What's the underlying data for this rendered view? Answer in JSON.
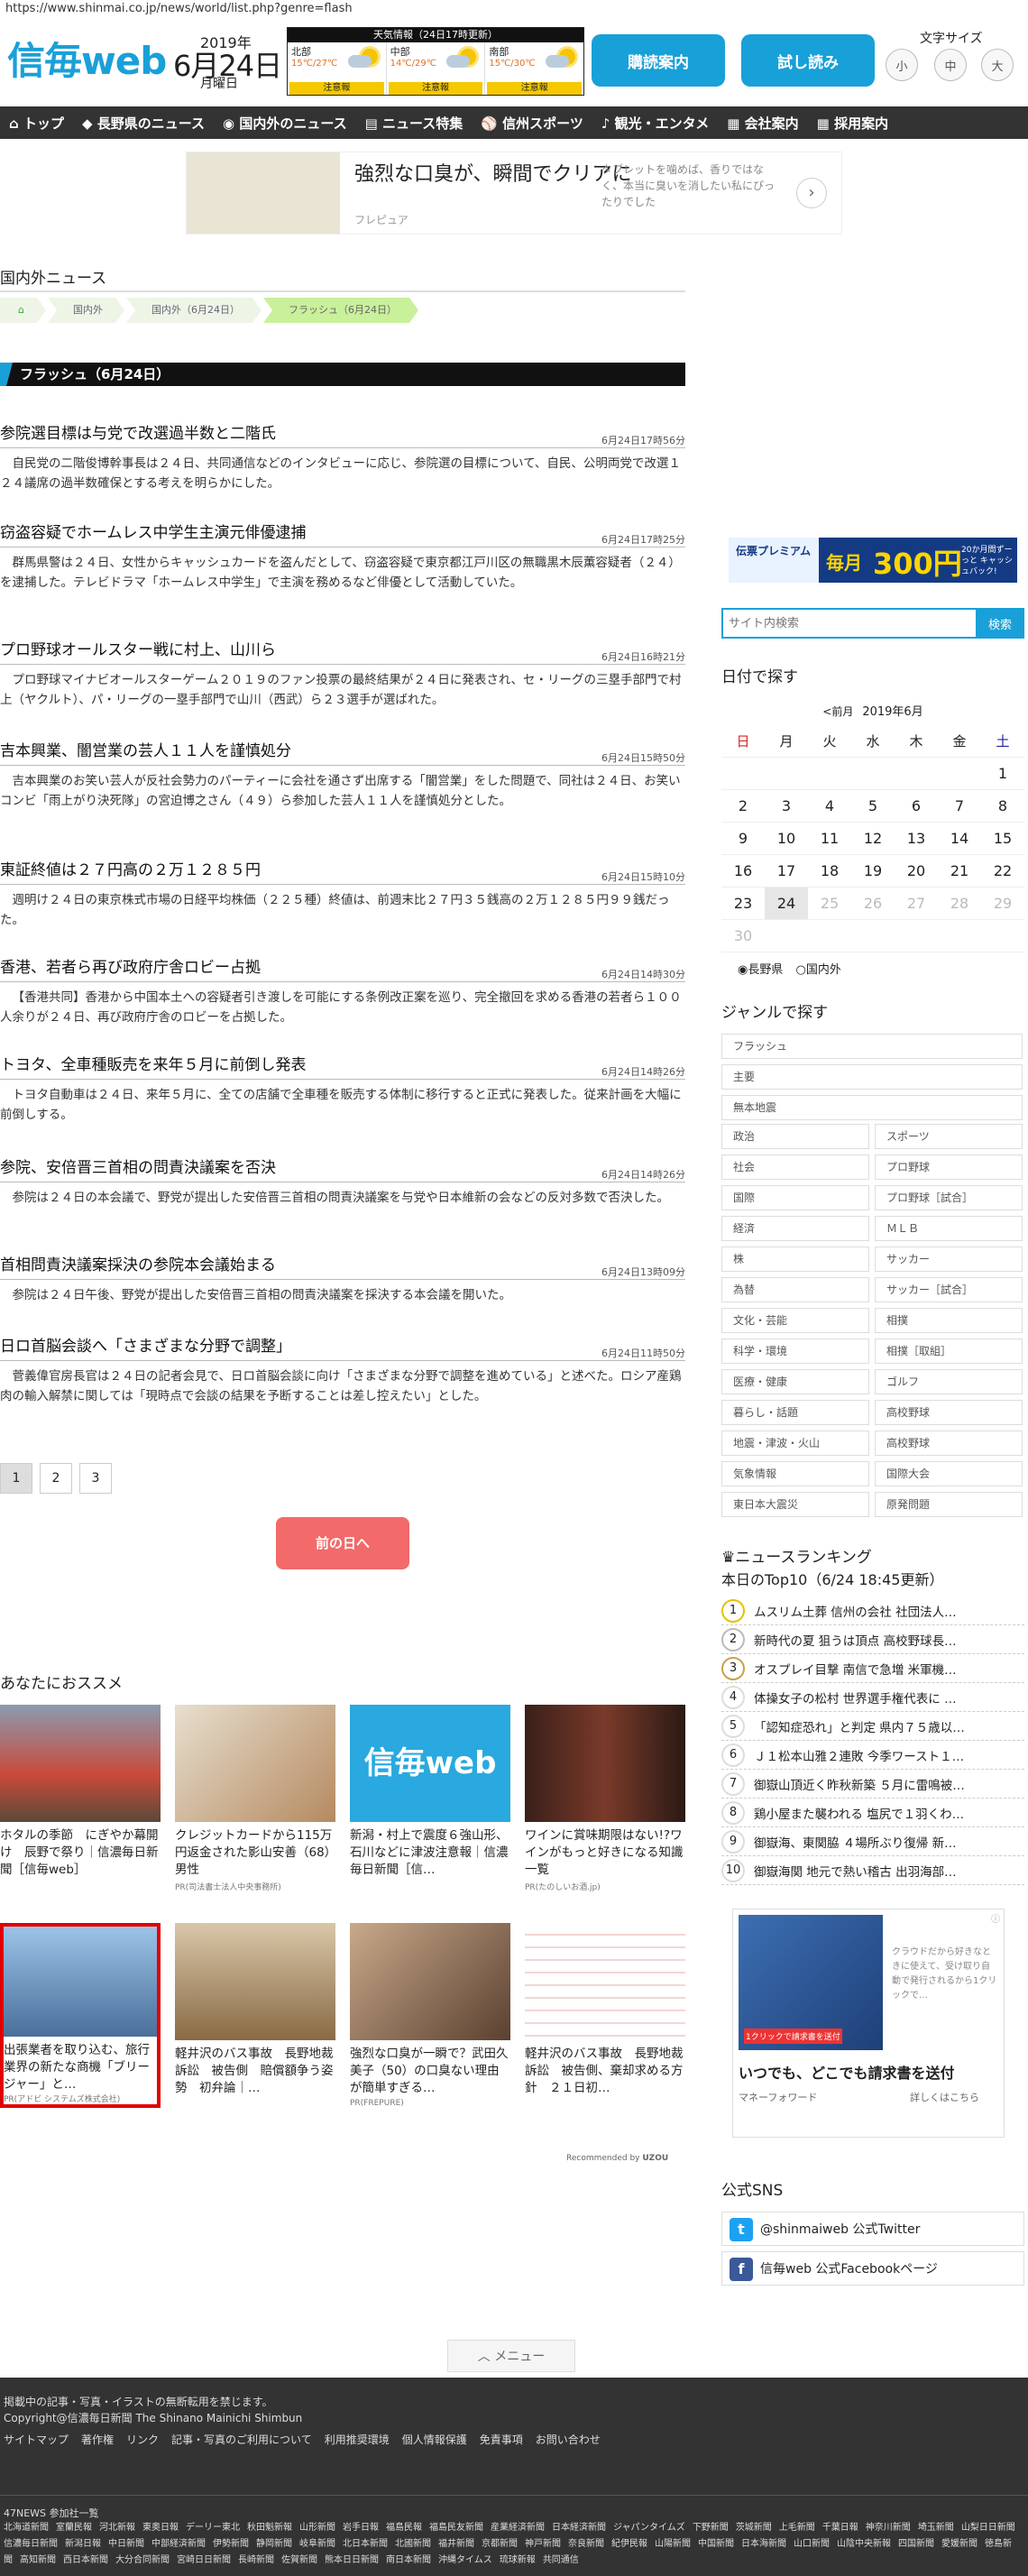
{
  "url": "https://www.shinmai.co.jp/news/world/list.php?genre=flash",
  "header": {
    "logo": "信毎web",
    "year": "2019年",
    "day": "6月24日",
    "weekday": "月曜日",
    "weather": {
      "title": "天気情報（24日17時更新）",
      "regions": [
        {
          "name": "北部",
          "temps": "15℃/27℃",
          "warn": "注意報"
        },
        {
          "name": "中部",
          "temps": "14℃/29℃",
          "warn": "注意報"
        },
        {
          "name": "南部",
          "temps": "15℃/30℃",
          "warn": "注意報"
        }
      ]
    },
    "subscribe": "購読案内",
    "trial": "試し読み",
    "font_size_label": "文字サイズ",
    "font_sizes": [
      "小",
      "中",
      "大"
    ]
  },
  "nav": [
    "トップ",
    "長野県のニュース",
    "国内外のニュース",
    "ニュース特集",
    "信州スポーツ",
    "観光・エンタメ",
    "会社案内",
    "採用案内"
  ],
  "ad_top": {
    "headline": "強烈な口臭が、瞬間でクリアに",
    "brand": "フレピュア",
    "desc": "タブレットを噛めば、香りではなく、本当に臭いを消したい私にぴったりでした"
  },
  "section_title": "国内外ニュース",
  "breadcrumbs": [
    "国内外",
    "国内外（6月24日）",
    "フラッシュ（6月24日）"
  ],
  "flash_title": "フラッシュ（6月24日）",
  "articles": [
    {
      "title": "参院選目標は与党で改選過半数と二階氏",
      "date": "6月24日17時56分",
      "summary": "自民党の二階俊博幹事長は２４日、共同通信などのインタビューに応じ、参院選の目標について、自民、公明両党で改選１２４議席の過半数確保とする考えを明らかにした。"
    },
    {
      "title": "窃盗容疑でホームレス中学生主演元俳優逮捕",
      "date": "6月24日17時25分",
      "summary": "群馬県警は２４日、女性からキャッシュカードを盗んだとして、窃盗容疑で東京都江戸川区の無職黒木辰薫容疑者（２４）を逮捕した。テレビドラマ「ホームレス中学生」で主演を務めるなど俳優として活動していた。"
    },
    {
      "title": "プロ野球オールスター戦に村上、山川ら",
      "date": "6月24日16時21分",
      "summary": "プロ野球マイナビオールスターゲーム２０１９のファン投票の最終結果が２４日に発表され、セ・リーグの三塁手部門で村上（ヤクルト）、パ・リーグの一塁手部門で山川（西武）ら２３選手が選ばれた。"
    },
    {
      "title": "吉本興業、闇営業の芸人１１人を謹慎処分",
      "date": "6月24日15時50分",
      "summary": "吉本興業のお笑い芸人が反社会勢力のパーティーに会社を通さず出席する「闇営業」をした問題で、同社は２４日、お笑いコンビ「雨上がり決死隊」の宮迫博之さん（４９）ら参加した芸人１１人を謹慎処分とした。"
    },
    {
      "title": "東証終値は２７円高の２万１２８５円",
      "date": "6月24日15時10分",
      "summary": "週明け２４日の東京株式市場の日経平均株価（２２５種）終値は、前週末比２７円３５銭高の２万１２８５円９９銭だった。"
    },
    {
      "title": "香港、若者ら再び政府庁舎ロビー占拠",
      "date": "6月24日14時30分",
      "summary": "【香港共同】香港から中国本土への容疑者引き渡しを可能にする条例改正案を巡り、完全撤回を求める香港の若者ら１００人余りが２４日、再び政府庁舎のロビーを占拠した。"
    },
    {
      "title": "トヨタ、全車種販売を来年５月に前倒し発表",
      "date": "6月24日14時26分",
      "summary": "トヨタ自動車は２４日、来年５月に、全ての店舗で全車種を販売する体制に移行すると正式に発表した。従来計画を大幅に前倒しする。"
    },
    {
      "title": "参院、安倍晋三首相の問責決議案を否決",
      "date": "6月24日14時26分",
      "summary": "参院は２４日の本会議で、野党が提出した安倍晋三首相の問責決議案を与党や日本維新の会などの反対多数で否決した。"
    },
    {
      "title": "首相問責決議案採決の参院本会議始まる",
      "date": "6月24日13時09分",
      "summary": "参院は２４日午後、野党が提出した安倍晋三首相の問責決議案を採決する本会議を開いた。"
    },
    {
      "title": "日ロ首脳会談へ「さまざまな分野で調整」",
      "date": "6月24日11時50分",
      "summary": "菅義偉官房長官は２４日の記者会見で、日ロ首脳会談に向け「さまざまな分野で調整を進めている」と述べた。ロシア産鶏肉の輸入解禁に関しては「現時点で会談の結果を予断することは差し控えたい」とした。"
    }
  ],
  "pager": [
    "1",
    "2",
    "3"
  ],
  "prev_day": "前の日へ",
  "recommend": {
    "title": "あなたにおススメ",
    "by": "Recommended by",
    "by_brand": "UZOU",
    "items": [
      {
        "caption": "ホタルの季節　にぎやか幕開け　辰野で祭り｜信濃毎日新聞［信毎web］",
        "pr": ""
      },
      {
        "caption": "クレジットカードから115万円返金された影山安善（68）男性",
        "pr": "PR(司法書士法人中央事務所)"
      },
      {
        "caption": "新潟・村上で震度６強山形、石川などに津波注意報｜信濃毎日新聞［信…",
        "pr": ""
      },
      {
        "caption": "ワインに賞味期限はない!?ワインがもっと好きになる知識一覧",
        "pr": "PR(たのしいお酒.jp)"
      },
      {
        "caption": "出張業者を取り込む、旅行業界の新たな商機「ブリージャー」と…",
        "pr": "PR(アドビ システムズ株式会社)"
      },
      {
        "caption": "軽井沢のバス事故　長野地裁訴訟　被告側　賠償額争う姿勢　初弁論｜…",
        "pr": ""
      },
      {
        "caption": "強烈な口臭が一瞬で？武田久美子（50）の口臭ない理由が簡単すぎる…",
        "pr": "PR(FREPURE)"
      },
      {
        "caption": "軽井沢のバス事故　長野地裁訴訟　被告側、棄却求める方針　２１日初…",
        "pr": ""
      }
    ]
  },
  "footer": {
    "menu": "メニュー",
    "notice": "掲載中の記事・写真・イラストの無断転用を禁じます。",
    "copyright": "Copyright@信濃毎日新聞 The Shinano Mainichi Shimbun",
    "links": [
      "サイトマップ",
      "著作権",
      "リンク",
      "記事・写真のご利用について",
      "利用推奨環境",
      "個人情報保護",
      "免責事項",
      "お問い合わせ"
    ],
    "p47": "47NEWS 参加社一覧",
    "papers": [
      "北海道新聞",
      "室蘭民報",
      "河北新報",
      "東奥日報",
      "デーリー東北",
      "秋田魁新報",
      "山形新聞",
      "岩手日報",
      "福島民報",
      "福島民友新聞",
      "産業経済新聞",
      "日本経済新聞",
      "ジャパンタイムズ",
      "下野新聞",
      "茨城新聞",
      "上毛新聞",
      "千葉日報",
      "神奈川新聞",
      "埼玉新聞",
      "山梨日日新聞",
      "信濃毎日新聞",
      "新潟日報",
      "中日新聞",
      "中部経済新聞",
      "伊勢新聞",
      "静岡新聞",
      "岐阜新聞",
      "北日本新聞",
      "北國新聞",
      "福井新聞",
      "京都新聞",
      "神戸新聞",
      "奈良新聞",
      "紀伊民報",
      "山陽新聞",
      "中国新聞",
      "日本海新聞",
      "山口新聞",
      "山陰中央新報",
      "四国新聞",
      "愛媛新聞",
      "徳島新聞",
      "高知新聞",
      "西日本新聞",
      "大分合同新聞",
      "宮崎日日新聞",
      "長崎新聞",
      "佐賀新聞",
      "熊本日日新聞",
      "南日本新聞",
      "沖縄タイムス",
      "琉球新報",
      "共同通信"
    ]
  },
  "sidebar": {
    "ad1": {
      "brand": "伝票プレミアム",
      "line": "毎月",
      "amount": "300円",
      "tail": "20か月間ずーっと キャッシュバック!"
    },
    "search": {
      "placeholder": "サイト内検索",
      "button": "検索"
    },
    "date_title": "日付で探す",
    "cal_prev": "<前月",
    "cal_month": "2019年6月",
    "weekdays": [
      "日",
      "月",
      "火",
      "水",
      "木",
      "金",
      "土"
    ],
    "cal": [
      [
        "",
        "",
        "",
        "",
        "",
        "",
        "1"
      ],
      [
        "2",
        "3",
        "4",
        "5",
        "6",
        "7",
        "8"
      ],
      [
        "9",
        "10",
        "11",
        "12",
        "13",
        "14",
        "15"
      ],
      [
        "16",
        "17",
        "18",
        "19",
        "20",
        "21",
        "22"
      ],
      [
        "23",
        "24",
        "25",
        "26",
        "27",
        "28",
        "29"
      ],
      [
        "30",
        "",
        "",
        "",
        "",
        "",
        ""
      ]
    ],
    "region": [
      "長野県",
      "国内外"
    ],
    "genre_title": "ジャンルで探す",
    "genres_full": [
      "フラッシュ",
      "主要",
      "無本地震"
    ],
    "genres": [
      [
        "政治",
        "スポーツ"
      ],
      [
        "社会",
        "プロ野球"
      ],
      [
        "国際",
        "プロ野球［試合］"
      ],
      [
        "経済",
        "ＭＬＢ"
      ],
      [
        "株",
        "サッカー"
      ],
      [
        "為替",
        "サッカー［試合］"
      ],
      [
        "文化・芸能",
        "相撲"
      ],
      [
        "科学・環境",
        "相撲［取組］"
      ],
      [
        "医療・健康",
        "ゴルフ"
      ],
      [
        "暮らし・話題",
        "高校野球"
      ],
      [
        "地震・津波・火山",
        "高校野球"
      ],
      [
        "気象情報",
        "国際大会"
      ],
      [
        "東日本大震災",
        "原発問題"
      ]
    ],
    "rank_title": "ニュースランキング",
    "rank_sub": "本日のTop10（6/24 18:45更新）",
    "ranking": [
      "ムスリム土葬 信州の会社 社団法人…",
      "新時代の夏 狙うは頂点 高校野球長…",
      "オスプレイ目撃 南信で急増 米軍機…",
      "体操女子の松村 世界選手権代表に …",
      "「認知症恐れ」と判定 県内７５歳以…",
      "Ｊ１松本山雅２連敗 今季ワースト１…",
      "御嶽山頂近く昨秋新築 ５月に雷鳴被…",
      "鶏小屋また襲われる 塩尻で１羽くわ…",
      "御嶽海、東関脇 ４場所ぶり復帰 新…",
      "御嶽海関 地元で熱い稽古 出羽海部…"
    ],
    "ad2": {
      "line1": "クラウドだから好きなときに使えて、受け取り自動で発行されるから1クリックで…",
      "headline": "いつでも、どこでも請求書を送付",
      "brand": "マネーフォワード",
      "more": "詳しくはこちら",
      "badge": "1クリックで請求書を送付"
    },
    "sns_title": "公式SNS",
    "twitter": "@shinmaiweb 公式Twitter",
    "facebook": "信毎web 公式Facebookページ"
  }
}
